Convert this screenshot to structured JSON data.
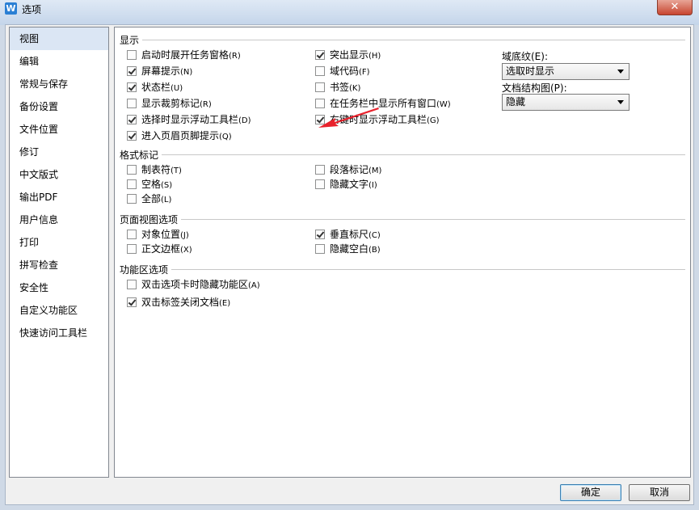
{
  "window": {
    "title": "选项",
    "icon": "wps-writer-icon",
    "close_label": "✕"
  },
  "sidebar": {
    "items": [
      {
        "label": "视图",
        "active": true
      },
      {
        "label": "编辑"
      },
      {
        "label": "常规与保存"
      },
      {
        "label": "备份设置"
      },
      {
        "label": "文件位置"
      },
      {
        "label": "修订"
      },
      {
        "label": "中文版式"
      },
      {
        "label": "输出PDF"
      },
      {
        "label": "用户信息"
      },
      {
        "label": "打印"
      },
      {
        "label": "拼写检查"
      },
      {
        "label": "安全性"
      },
      {
        "label": "自定义功能区"
      },
      {
        "label": "快速访问工具栏"
      }
    ]
  },
  "display": {
    "title": "显示",
    "options": [
      {
        "label": "启动时展开任务窗格",
        "hotkey": "(R)",
        "checked": false
      },
      {
        "label": "屏幕提示",
        "hotkey": "(N)",
        "checked": true
      },
      {
        "label": "状态栏",
        "hotkey": "(U)",
        "checked": true
      },
      {
        "label": "显示裁剪标记",
        "hotkey": "(R)",
        "checked": false
      },
      {
        "label": "选择时显示浮动工具栏",
        "hotkey": "(D)",
        "checked": true
      },
      {
        "label": "进入页眉页脚提示",
        "hotkey": "(Q)",
        "checked": true
      },
      {
        "label": "突出显示",
        "hotkey": "(H)",
        "checked": true
      },
      {
        "label": "域代码",
        "hotkey": "(F)",
        "checked": false
      },
      {
        "label": "书签",
        "hotkey": "(K)",
        "checked": false
      },
      {
        "label": "在任务栏中显示所有窗口",
        "hotkey": "(W)",
        "checked": false
      },
      {
        "label": "右键时显示浮动工具栏",
        "hotkey": "(G)",
        "checked": true
      }
    ],
    "field_shading_label": "域底纹(E):",
    "field_shading_value": "选取时显示",
    "doc_map_label": "文档结构图(P):",
    "doc_map_value": "隐藏"
  },
  "format_marks": {
    "title": "格式标记",
    "options": [
      {
        "label": "制表符",
        "hotkey": "(T)",
        "checked": false
      },
      {
        "label": "空格",
        "hotkey": "(S)",
        "checked": false
      },
      {
        "label": "全部",
        "hotkey": "(L)",
        "checked": false
      },
      {
        "label": "段落标记",
        "hotkey": "(M)",
        "checked": false
      },
      {
        "label": "隐藏文字",
        "hotkey": "(I)",
        "checked": false
      }
    ]
  },
  "page_view": {
    "title": "页面视图选项",
    "options": [
      {
        "label": "对象位置",
        "hotkey": "(J)",
        "checked": false
      },
      {
        "label": "正文边框",
        "hotkey": "(X)",
        "checked": false
      },
      {
        "label": "垂直标尺",
        "hotkey": "(C)",
        "checked": true
      },
      {
        "label": "隐藏空白",
        "hotkey": "(B)",
        "checked": false
      }
    ]
  },
  "ribbon": {
    "title": "功能区选项",
    "options": [
      {
        "label": "双击选项卡时隐藏功能区",
        "hotkey": "(A)",
        "checked": false
      },
      {
        "label": "双击标签关闭文档",
        "hotkey": "(E)",
        "checked": true
      }
    ]
  },
  "footer": {
    "ok_label": "确定",
    "cancel_label": "取消"
  },
  "colors": {
    "annotation_arrow": "#e8222c",
    "sidebar_selected": "#dbe6f4"
  }
}
